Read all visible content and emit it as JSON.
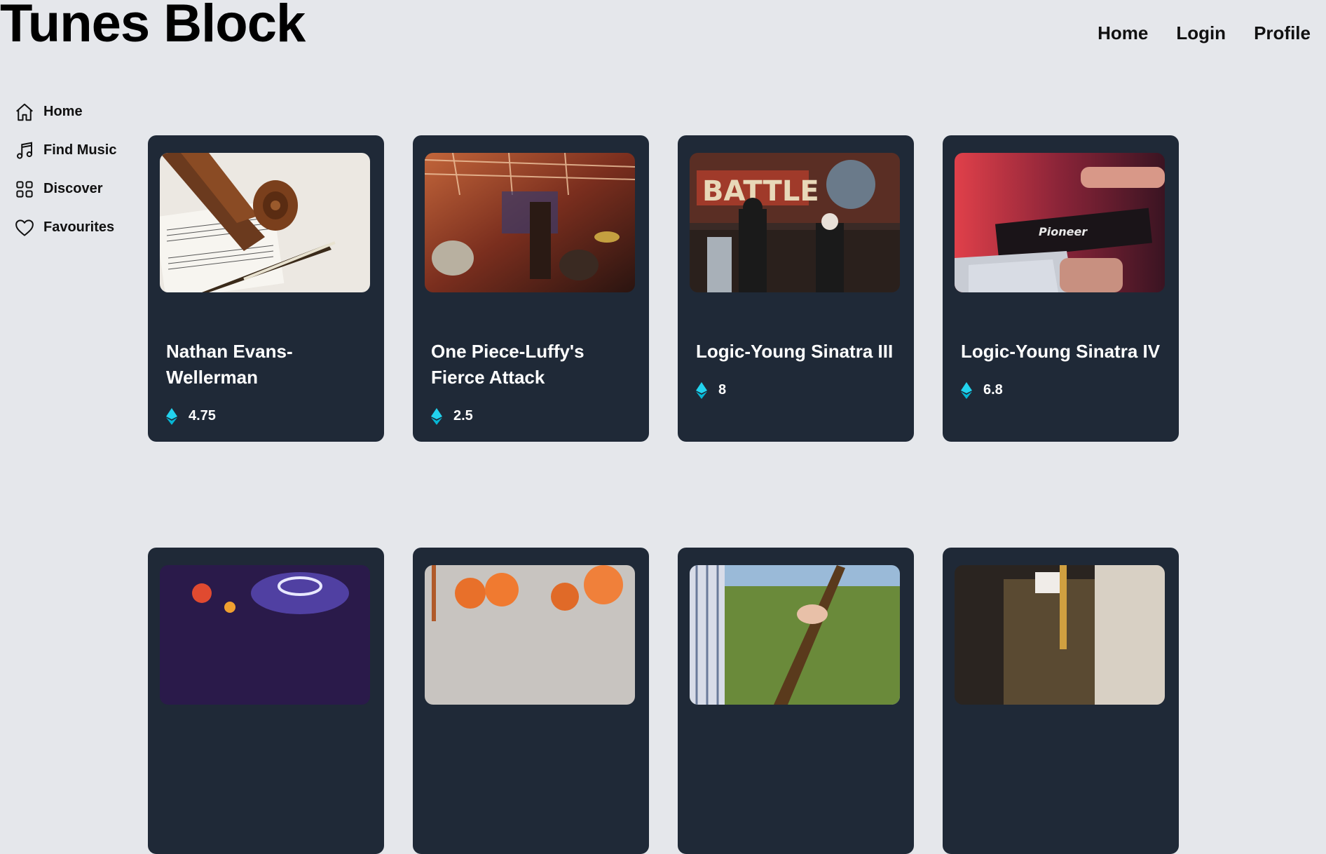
{
  "header": {
    "title": "Tunes Block"
  },
  "topnav": [
    "Home",
    "Login",
    "Profile"
  ],
  "sidebar": [
    {
      "label": "Home",
      "icon": "home-icon"
    },
    {
      "label": "Find Music",
      "icon": "music-note-icon"
    },
    {
      "label": "Discover",
      "icon": "grid-icon"
    },
    {
      "label": "Favourites",
      "icon": "heart-icon"
    }
  ],
  "cards": [
    {
      "title": "Nathan Evans-Wellerman",
      "price": "4.75",
      "image": "cello-sheet-music"
    },
    {
      "title": "One Piece-Luffy's Fierce Attack",
      "price": "2.5",
      "image": "rock-band-stage"
    },
    {
      "title": "Logic-Young Sinatra III",
      "price": "8",
      "image": "rap-battle-crowd"
    },
    {
      "title": "Logic-Young Sinatra IV",
      "price": "6.8",
      "image": "dj-mixer-laptop"
    },
    {
      "title": "",
      "price": "",
      "image": "dj-turntable-lights"
    },
    {
      "title": "",
      "price": "",
      "image": "orange-turbans-crowd"
    },
    {
      "title": "",
      "price": "",
      "image": "guitar-field"
    },
    {
      "title": "",
      "price": "",
      "image": "saxophone-player"
    }
  ],
  "colors": {
    "card_bg": "#1f2937",
    "page_bg": "#e5e7eb",
    "eth_accent": "#22d3ee"
  }
}
